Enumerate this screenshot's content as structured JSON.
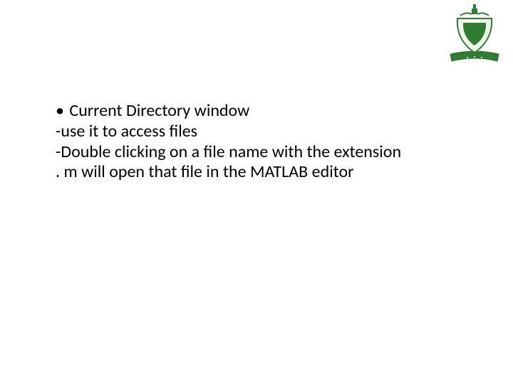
{
  "slide": {
    "line1_bullet": "•",
    "line1_text": "Current Directory window",
    "line2": "-use it to access files",
    "line3": "-Double clicking on a file name with the extension",
    "line4": ". m will open that file in the MATLAB editor"
  },
  "logo": {
    "name": "university-crest"
  }
}
